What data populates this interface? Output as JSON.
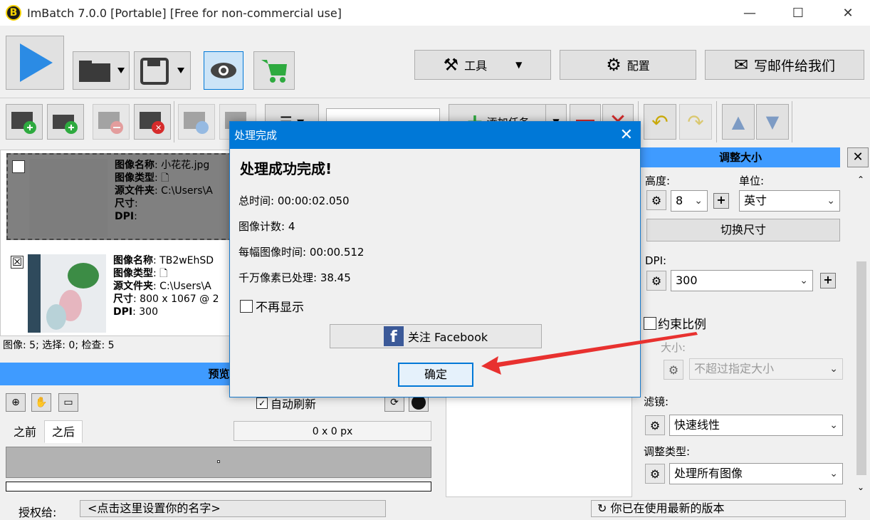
{
  "window": {
    "logo_letter": "B",
    "title": "ImBatch 7.0.0 [Portable] [Free for non-commercial use]",
    "min": "—",
    "max": "☐",
    "close": "✕"
  },
  "toolbar": {
    "tools_label": "工具",
    "settings_label": "配置",
    "mail_label": "写邮件给我们",
    "add_task_label": "添加任务"
  },
  "images": [
    {
      "checked": false,
      "name_label": "图像名称",
      "name": "小花花.jpg",
      "type_label": "图像类型",
      "folder_label": "源文件夹",
      "folder": "C:\\Users\\A",
      "size_label": "尺寸",
      "size": "",
      "dpi_label": "DPI",
      "dpi": ""
    },
    {
      "checked": true,
      "name_label": "图像名称",
      "name": "TB2wEhSD",
      "type_label": "图像类型",
      "folder_label": "源文件夹",
      "folder": "C:\\Users\\A",
      "size_label": "尺寸",
      "size": "800 x 1067 @ 2",
      "dpi_label": "DPI",
      "dpi": "300"
    }
  ],
  "status": {
    "text": "图像: 5; 选择: 0; 检查: 5"
  },
  "preview": {
    "header": "预览",
    "auto_refresh": "自动刷新",
    "tab_before": "之前",
    "tab_after": "之后",
    "dimensions": "0 x 0 px"
  },
  "resize_panel": {
    "header": "调整大小",
    "height_label": "高度:",
    "unit_label": "单位:",
    "height_value": "8",
    "unit_value": "英寸",
    "switch_btn": "切换尺寸",
    "dpi_label": "DPI:",
    "dpi_value": "300",
    "constrain_label": "约束比例",
    "size_label": "大小:",
    "size_value": "不超过指定大小",
    "filter_label": "滤镜:",
    "filter_value": "快速线性",
    "resize_type_label": "调整类型:",
    "resize_type_value": "处理所有图像"
  },
  "footer": {
    "license_label": "授权给:",
    "license_value": "<点击这里设置你的名字>",
    "version_text": "你已在使用最新的版本"
  },
  "dialog": {
    "title": "处理完成",
    "close": "✕",
    "heading": "处理成功完成!",
    "total_time": "总时间: 00:00:02.050",
    "image_count": "图像计数: 4",
    "per_image_time": "每幅图像时间: 00:00.512",
    "megapixels": "千万像素已处理: 38.45",
    "dont_show": "不再显示",
    "facebook": "关注 Facebook",
    "ok": "确定"
  },
  "colors": {
    "accent": "#0078d7",
    "panel_header": "#3f9bff",
    "arrow": "#e8312f"
  }
}
